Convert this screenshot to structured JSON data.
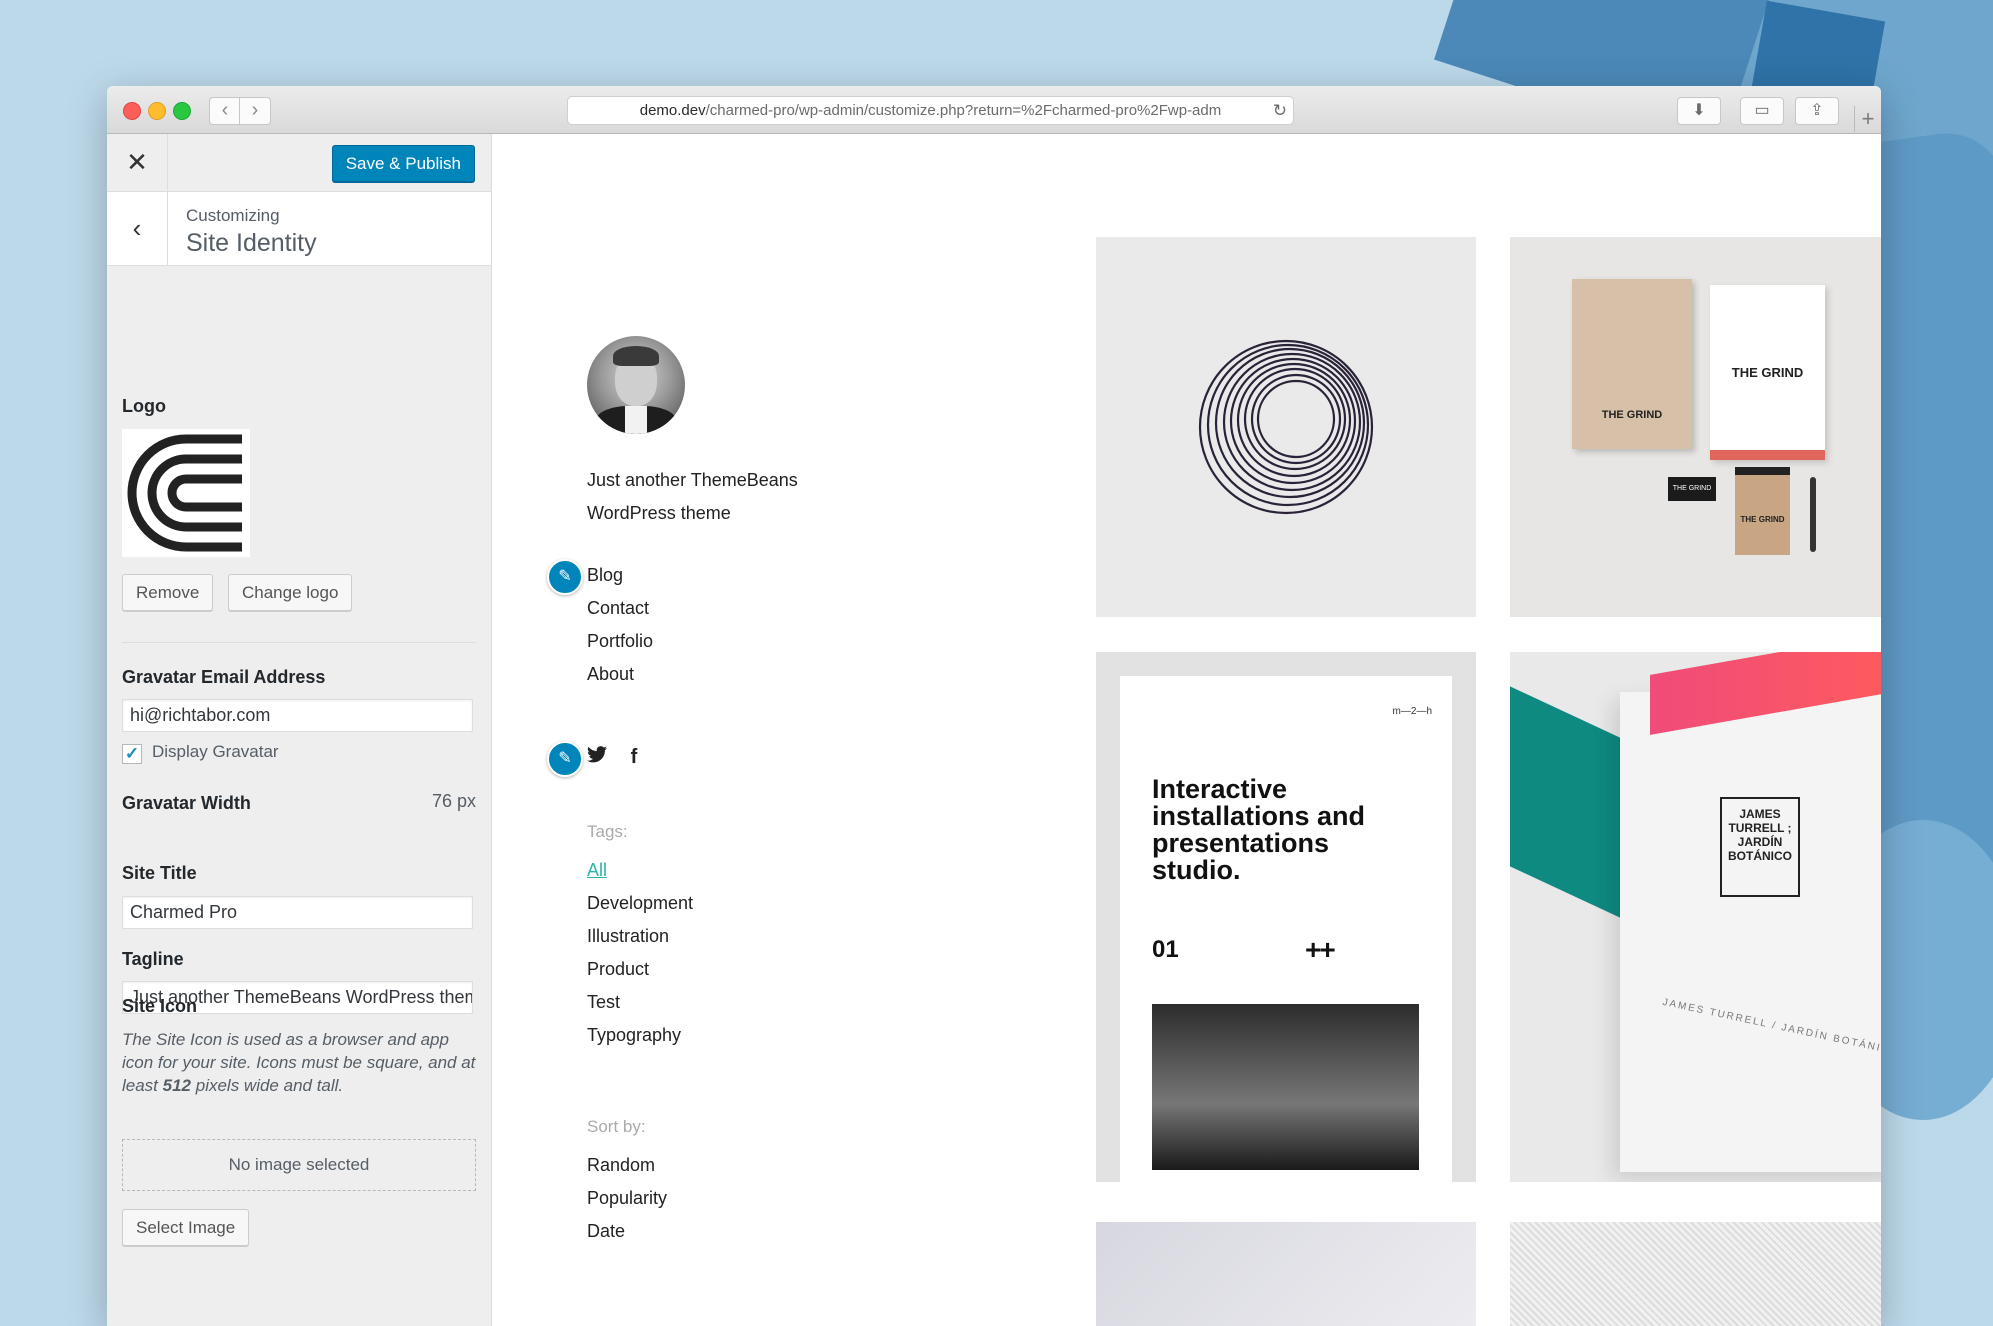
{
  "browser": {
    "url_host": "demo.dev",
    "url_path": "/charmed-pro/wp-admin/customize.php?return=%2Fcharmed-pro%2Fwp-adm",
    "icons": [
      "close-dot",
      "minimize-dot",
      "zoom-dot",
      "back-icon",
      "forward-icon",
      "reload-icon",
      "download-icon",
      "tabs-icon",
      "share-icon",
      "new-tab-icon"
    ]
  },
  "customizer": {
    "close_glyph": "✕",
    "save_label": "Save & Publish",
    "back_glyph": "‹",
    "customizing_label": "Customizing",
    "section_title": "Site Identity",
    "logo_label": "Logo",
    "remove_label": "Remove",
    "change_logo_label": "Change logo",
    "gravatar_email_label": "Gravatar Email Address",
    "gravatar_email_value": "hi@richtabor.com",
    "display_gravatar_label": "Display Gravatar",
    "display_gravatar_checked": true,
    "gravatar_width_label": "Gravatar Width",
    "gravatar_width_value": "76 px",
    "site_title_label": "Site Title",
    "site_title_value": "Charmed Pro",
    "tagline_label": "Tagline",
    "tagline_value": "Just another ThemeBeans WordPress theme",
    "site_icon_label": "Site Icon",
    "site_icon_desc_1": "The Site Icon is used as a browser and app icon for your site. Icons must be square, and at least ",
    "site_icon_desc_bold": "512",
    "site_icon_desc_2": " pixels wide and tall.",
    "no_image_label": "No image selected",
    "select_image_label": "Select Image",
    "accent_color": "#0085ba"
  },
  "preview": {
    "tagline_line1": "Just another ThemeBeans",
    "tagline_line2": "WordPress theme",
    "menu": [
      "Blog",
      "Contact",
      "Portfolio",
      "About"
    ],
    "social": [
      "twitter-icon",
      "facebook-icon"
    ],
    "social_glyphs": [
      "🐦",
      "f"
    ],
    "tags_label": "Tags:",
    "tags": [
      "All",
      "Development",
      "Illustration",
      "Product",
      "Test",
      "Typography"
    ],
    "sort_label": "Sort by:",
    "sort": [
      "Random",
      "Popularity",
      "Date"
    ],
    "active_tag_color": "#2bb5a7",
    "poster": {
      "mark": "m—2—h",
      "headline": "Interactive installations and presentations studio.",
      "number": "01",
      "plus": "++"
    },
    "grind_text": "THE GRIND",
    "stamp_text": "JAMES TURRELL ; JARDÍN BOTÁNICO",
    "jt_text": "JAMES TURRELL / JARDÍN BOTÁNICO"
  }
}
